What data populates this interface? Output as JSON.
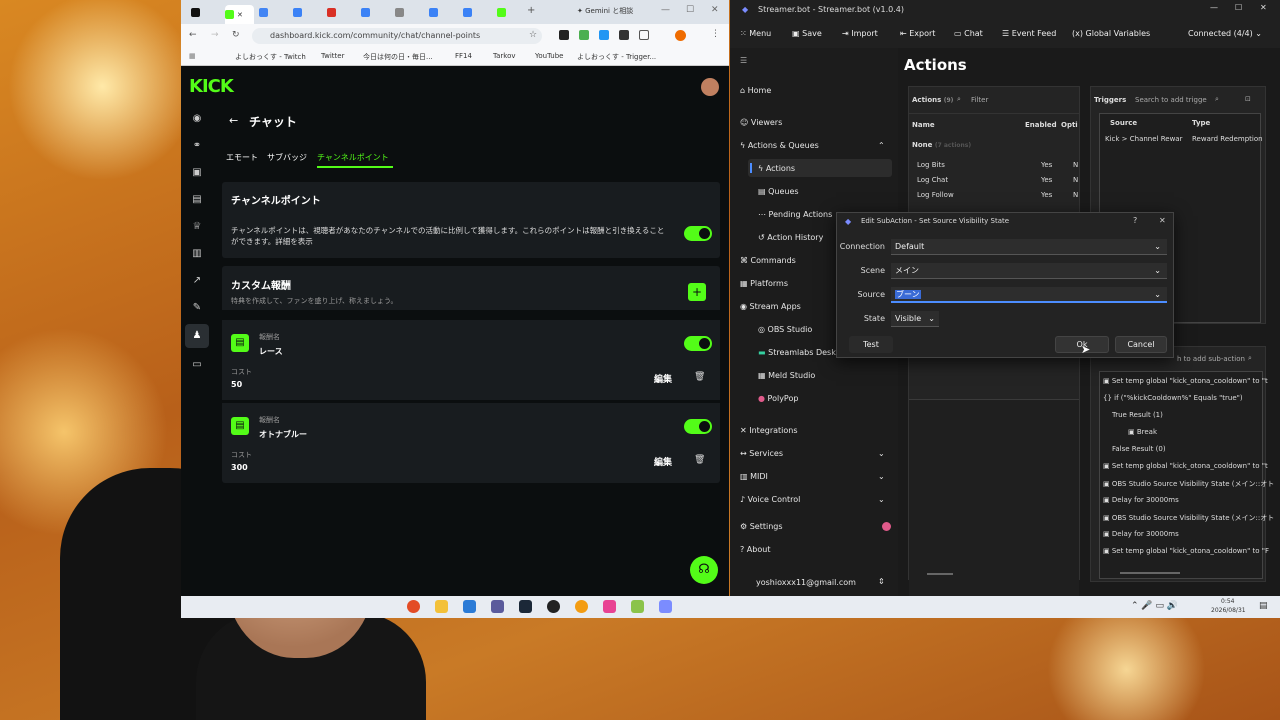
{
  "browser": {
    "active_tab_title": "Gemini と相談",
    "url": "dashboard.kick.com/community/chat/channel-points",
    "bookmarks": [
      "よしおっくす - Twitch",
      "Twitter",
      "今日は何の日・毎日...",
      "FF14",
      "Tarkov",
      "YouTube",
      "よしおっくす - Trigger..."
    ]
  },
  "kick": {
    "logo": "KICK",
    "page_title": "チャット",
    "tabs": [
      "エモート",
      "サブバッジ",
      "チャンネルポイント"
    ],
    "section_title": "チャンネルポイント",
    "section_desc": "チャンネルポイントは、視聴者があなたのチャンネルでの活動に比例して獲得します。これらのポイントは報酬と引き換えることができます。詳細を表示",
    "custom_title": "カスタム報酬",
    "custom_desc": "特典を作成して、ファンを盛り上げ、称えましょう。",
    "reward_name_label": "報酬名",
    "cost_label": "コスト",
    "edit_label": "編集",
    "rewards": [
      {
        "name": "レース",
        "cost": "50"
      },
      {
        "name": "オトナブルー",
        "cost": "300"
      }
    ]
  },
  "sb": {
    "title": "Streamer.bot - Streamer.bot (v1.0.4)",
    "menu": [
      "Menu",
      "Save",
      "Import",
      "Export",
      "Chat",
      "Event Feed",
      "Global Variables"
    ],
    "connected": "Connected (4/4)",
    "nav": [
      "Home",
      "Viewers",
      "Actions & Queues",
      "Actions",
      "Queues",
      "Pending Actions",
      "Action History",
      "Commands",
      "Platforms",
      "Stream Apps",
      "OBS Studio",
      "Streamlabs Desk",
      "Meld Studio",
      "PolyPop",
      "Integrations",
      "Services",
      "MIDI",
      "Voice Control",
      "Settings",
      "About"
    ],
    "account": "yoshioxxx11@gmail.com",
    "heading": "Actions",
    "actions_label": "Actions",
    "actions_count": "(9)",
    "filter_placeholder": "Filter",
    "cols": [
      "Name",
      "Enabled",
      "Opti"
    ],
    "group": "None",
    "group_count": "(7 actions)",
    "actions": [
      {
        "name": "Log Bits",
        "enabled": "Yes",
        "opt": "N"
      },
      {
        "name": "Log Chat",
        "enabled": "Yes",
        "opt": "N"
      },
      {
        "name": "Log Follow",
        "enabled": "Yes",
        "opt": "N"
      }
    ],
    "triggers_label": "Triggers",
    "triggers_search": "Search to add trigge",
    "trigger_cols": [
      "Source",
      "Type"
    ],
    "trigger_row": {
      "source": "Kick > Channel Rewar",
      "type": "Reward Redemption"
    },
    "subaction_search": "h to add sub-action",
    "subactions": [
      "Set temp global \"kick_otona_cooldown\" to \"t",
      "if (\"%kickCooldown%\" Equals \"true\")",
      "True Result (1)",
      "Break",
      "False Result (0)",
      "Set temp global \"kick_otona_cooldown\" to \"t",
      "OBS Studio Source Visibility State (メイン::オト",
      "Delay for 30000ms",
      "OBS Studio Source Visibility State (メイン::オト",
      "Delay for 30000ms",
      "Set temp global \"kick_otona_cooldown\" to \"F"
    ]
  },
  "dialog": {
    "title": "Edit SubAction - Set Source Visibility State",
    "connection_label": "Connection",
    "connection_value": "Default",
    "scene_label": "Scene",
    "scene_value": "メイン",
    "source_label": "Source",
    "source_value": "ブーン",
    "state_label": "State",
    "state_value": "Visible",
    "test": "Test",
    "ok": "Ok",
    "cancel": "Cancel"
  },
  "taskbar": {
    "time": "0:54",
    "date": "2026/08/31"
  },
  "colors": {
    "kick_green": "#53fc18",
    "sb_bg": "#1a1a1a"
  }
}
